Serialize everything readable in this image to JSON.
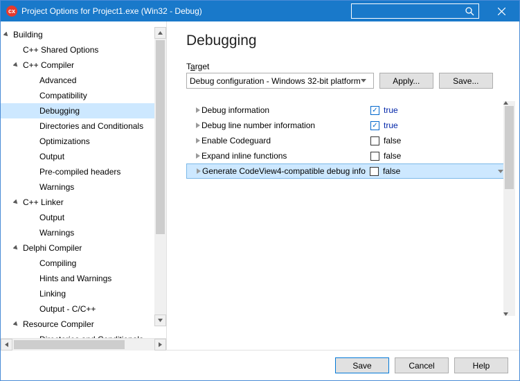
{
  "titlebar": {
    "title": "Project Options for Project1.exe  (Win32 - Debug)",
    "app_icon_text": "cx"
  },
  "sidebar": {
    "items": [
      {
        "label": "Building",
        "level": 0,
        "expander": "▾",
        "selected": false
      },
      {
        "label": "C++ Shared Options",
        "level": 1,
        "expander": "",
        "selected": false
      },
      {
        "label": "C++ Compiler",
        "level": 1,
        "expander": "▾",
        "selected": false
      },
      {
        "label": "Advanced",
        "level": 2,
        "expander": "",
        "selected": false
      },
      {
        "label": "Compatibility",
        "level": 2,
        "expander": "",
        "selected": false
      },
      {
        "label": "Debugging",
        "level": 2,
        "expander": "",
        "selected": true
      },
      {
        "label": "Directories and Conditionals",
        "level": 2,
        "expander": "",
        "selected": false
      },
      {
        "label": "Optimizations",
        "level": 2,
        "expander": "",
        "selected": false
      },
      {
        "label": "Output",
        "level": 2,
        "expander": "",
        "selected": false
      },
      {
        "label": "Pre-compiled headers",
        "level": 2,
        "expander": "",
        "selected": false
      },
      {
        "label": "Warnings",
        "level": 2,
        "expander": "",
        "selected": false
      },
      {
        "label": "C++ Linker",
        "level": 1,
        "expander": "▾",
        "selected": false
      },
      {
        "label": "Output",
        "level": 2,
        "expander": "",
        "selected": false
      },
      {
        "label": "Warnings",
        "level": 2,
        "expander": "",
        "selected": false
      },
      {
        "label": "Delphi Compiler",
        "level": 1,
        "expander": "▾",
        "selected": false
      },
      {
        "label": "Compiling",
        "level": 2,
        "expander": "",
        "selected": false
      },
      {
        "label": "Hints and Warnings",
        "level": 2,
        "expander": "",
        "selected": false
      },
      {
        "label": "Linking",
        "level": 2,
        "expander": "",
        "selected": false
      },
      {
        "label": "Output - C/C++",
        "level": 2,
        "expander": "",
        "selected": false
      },
      {
        "label": "Resource Compiler",
        "level": 1,
        "expander": "▾",
        "selected": false
      },
      {
        "label": "Directories and Conditionals",
        "level": 2,
        "expander": "",
        "selected": false
      }
    ]
  },
  "main": {
    "heading": "Debugging",
    "target_label_before": "T",
    "target_label_ul": "a",
    "target_label_after": "rget",
    "target_value": "Debug configuration - Windows 32-bit platform",
    "apply_label": "Apply...",
    "saveopt_label": "Save...",
    "rows": [
      {
        "name": "Debug information",
        "value": "true",
        "checked": true,
        "selected": false
      },
      {
        "name": "Debug line number information",
        "value": "true",
        "checked": true,
        "selected": false
      },
      {
        "name": "Enable Codeguard",
        "value": "false",
        "checked": false,
        "selected": false
      },
      {
        "name": "Expand inline functions",
        "value": "false",
        "checked": false,
        "selected": false
      },
      {
        "name": "Generate CodeView4-compatible debug info",
        "value": "false",
        "checked": false,
        "selected": true
      }
    ]
  },
  "footer": {
    "save": "Save",
    "cancel": "Cancel",
    "help": "Help"
  }
}
